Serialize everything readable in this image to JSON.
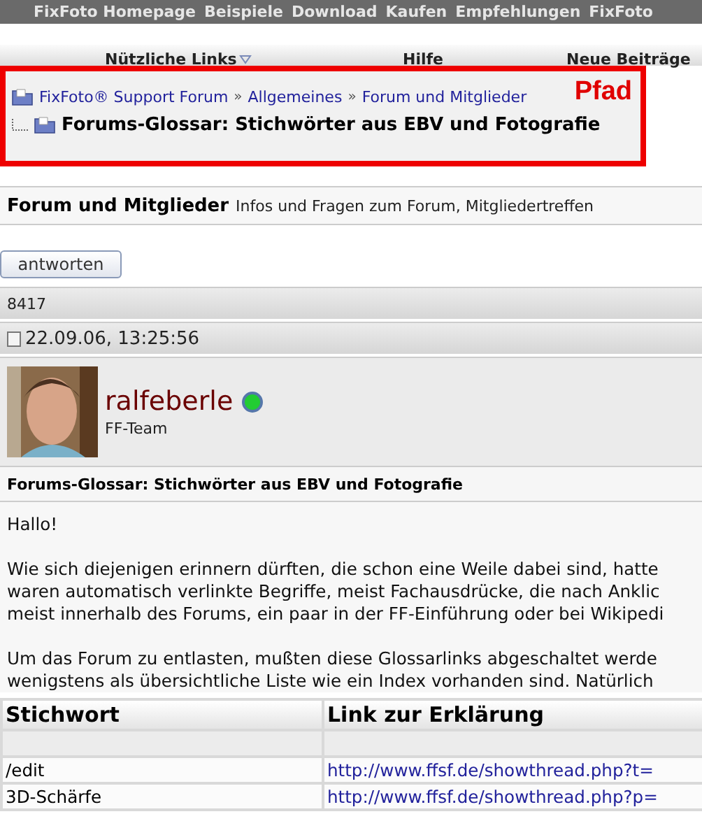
{
  "top_nav": [
    "FixFoto Homepage",
    "Beispiele",
    "Download",
    "Kaufen",
    "Empfehlungen",
    "FixFoto"
  ],
  "menu": [
    {
      "label": "Nützliche Links",
      "dropdown": true
    },
    {
      "label": "Hilfe",
      "dropdown": false
    },
    {
      "label": "Neue Beiträge",
      "dropdown": false
    }
  ],
  "path_box": {
    "label": "Pfad",
    "crumbs": [
      "FixFoto® Support Forum",
      "»",
      "Allgemeines",
      "»",
      "Forum und Mitglieder"
    ],
    "current": "Forums-Glossar: Stichwörter aus EBV und Fotografie"
  },
  "forum_header": {
    "title": "Forum und Mitglieder",
    "description": "Infos und Fragen zum Forum, Mitgliedertreffen"
  },
  "reply_button": "antworten",
  "post_count": "8417",
  "post_date": "22.09.06, 13:25:56",
  "author": {
    "name": "ralfeberle",
    "online": true,
    "role": "FF-Team"
  },
  "post_title": "Forums-Glossar: Stichwörter aus EBV und Fotografie",
  "paragraphs": [
    [
      "Hallo!"
    ],
    [
      "Wie sich diejenigen erinnern dürften, die schon eine Weile dabei sind, hatte",
      "waren automatisch verlinkte Begriffe, meist Fachausdrücke, die nach Anklic",
      "meist innerhalb des Forums, ein paar in der FF-Einführung oder bei Wikipedi"
    ],
    [
      "Um das Forum zu entlasten, mußten diese Glossarlinks abgeschaltet werde",
      "wenigstens als übersichtliche Liste wie ein Index vorhanden sind. Natürlich"
    ]
  ],
  "table": {
    "columns": [
      "Stichwort",
      "Link zur Erklärung"
    ],
    "rows": [
      {
        "term": "/edit",
        "link": "http://www.ffsf.de/showthread.php?t="
      },
      {
        "term": "3D-Schärfe",
        "link": "http://www.ffsf.de/showthread.php?p="
      }
    ]
  }
}
